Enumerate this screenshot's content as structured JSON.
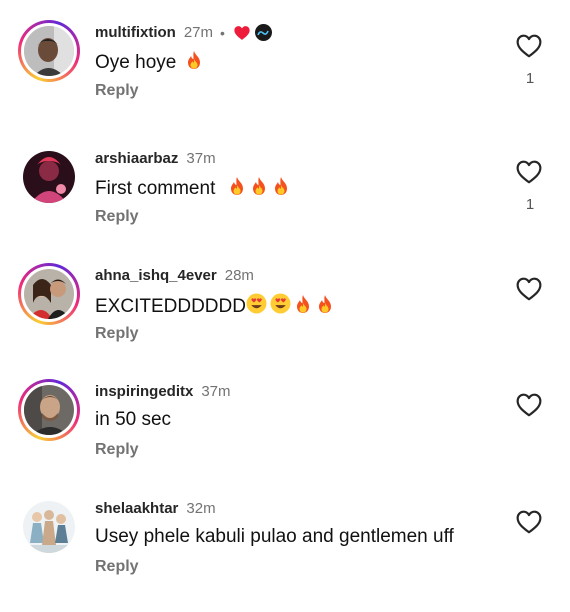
{
  "comments": [
    {
      "username": "multifixtion",
      "time": "27m",
      "text": "Oye hoye",
      "emojis": [
        "fire"
      ],
      "reply_label": "Reply",
      "likes": "1",
      "badges": [
        "creator-liked-heart",
        "creator-avatar"
      ]
    },
    {
      "username": "arshiaarbaz",
      "time": "37m",
      "text": "First comment",
      "emojis": [
        "fire",
        "fire",
        "fire"
      ],
      "reply_label": "Reply",
      "likes": "1"
    },
    {
      "username": "ahna_ishq_4ever",
      "time": "28m",
      "text": "EXCITEDDDDDD",
      "emojis": [
        "heart-eyes",
        "heart-eyes",
        "fire",
        "fire"
      ],
      "reply_label": "Reply",
      "likes": ""
    },
    {
      "username": "inspiringeditx",
      "time": "37m",
      "text": "in 50 sec",
      "emojis": [],
      "reply_label": "Reply",
      "likes": ""
    },
    {
      "username": "shelaakhtar",
      "time": "32m",
      "text": "Usey phele kabuli pulao and gentlemen uff",
      "emojis": [],
      "reply_label": "Reply",
      "likes": ""
    }
  ],
  "separator": "•",
  "icons": {
    "like": "heart-outline-icon",
    "fire": "fire-emoji-icon",
    "heart_eyes": "heart-eyes-emoji-icon"
  },
  "colors": {
    "username": "#262626",
    "muted": "#737373",
    "liked_heart": "#ed1c3a",
    "story_ring": [
      "#f9ce34",
      "#ee2a7b",
      "#6228d7"
    ]
  }
}
